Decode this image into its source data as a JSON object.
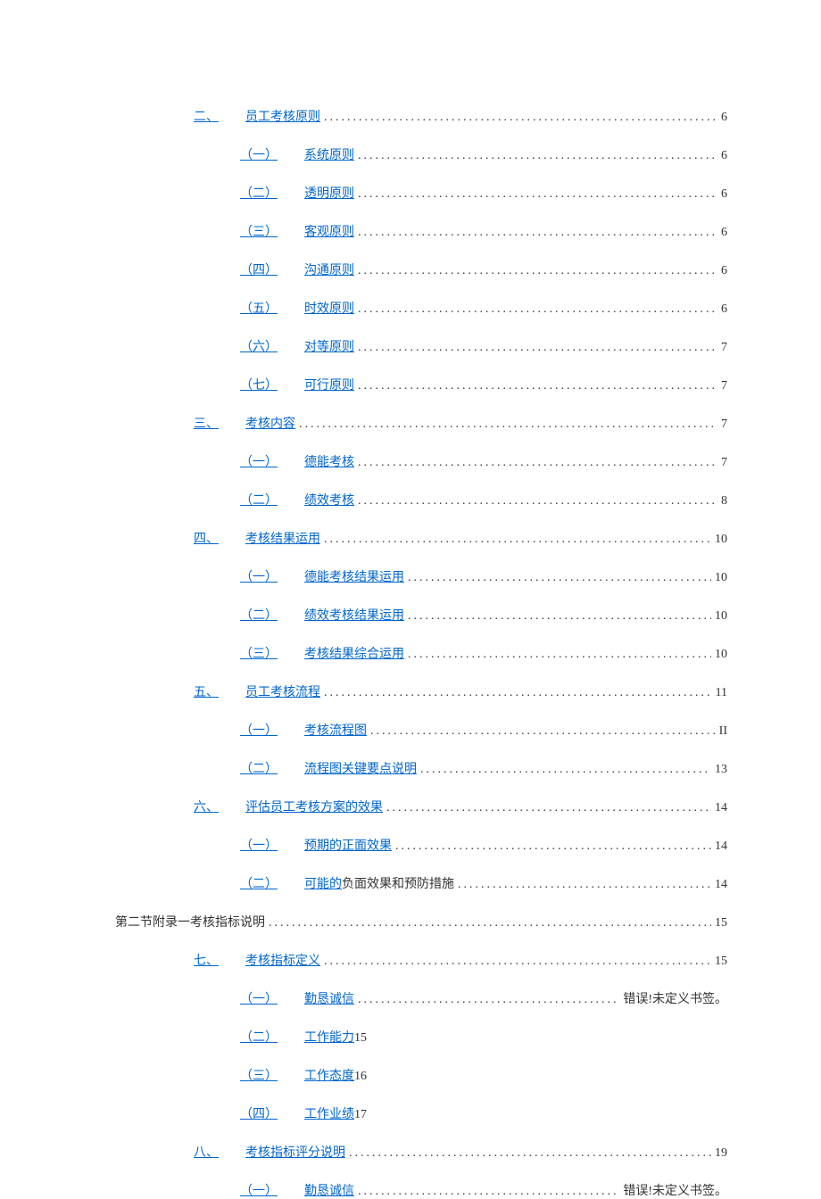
{
  "dots": "..................................................................................................",
  "error_text": "错误!未定义书签。",
  "toc": [
    {
      "level": 1,
      "prefix": "二、",
      "title": "员工考核原则",
      "page": "6",
      "style": "normal"
    },
    {
      "level": 2,
      "prefix": "（一）",
      "title": "系统原则",
      "page": "6",
      "style": "normal"
    },
    {
      "level": 2,
      "prefix": "（二）",
      "title": "透明原则",
      "page": "6",
      "style": "normal"
    },
    {
      "level": 2,
      "prefix": "（三）",
      "title": "客观原则",
      "page": "6",
      "style": "normal"
    },
    {
      "level": 2,
      "prefix": "（四）",
      "title": "沟通原则",
      "page": "6",
      "style": "normal"
    },
    {
      "level": 2,
      "prefix": "（五）",
      "title": "时效原则",
      "page": "6",
      "style": "normal"
    },
    {
      "level": 2,
      "prefix": "（六）",
      "title": "对等原则",
      "page": "7",
      "style": "normal"
    },
    {
      "level": 2,
      "prefix": "（七）",
      "title": "可行原则",
      "page": "7",
      "style": "normal"
    },
    {
      "level": 1,
      "prefix": "三、",
      "title": "考核内容",
      "page": "7",
      "style": "normal"
    },
    {
      "level": 2,
      "prefix": "（一）",
      "title": "德能考核",
      "page": "7",
      "style": "normal"
    },
    {
      "level": 2,
      "prefix": "（二）",
      "title": "绩效考核",
      "page": "8",
      "style": "normal"
    },
    {
      "level": 1,
      "prefix": "四、",
      "title": "考核结果运用",
      "page": "10",
      "style": "normal"
    },
    {
      "level": 2,
      "prefix": "（一）",
      "title": "德能考核结果运用",
      "page": "10",
      "style": "normal"
    },
    {
      "level": 2,
      "prefix": "（二）",
      "title": "绩效考核结果运用",
      "page": "10",
      "style": "normal"
    },
    {
      "level": 2,
      "prefix": "（三）",
      "title": "考核结果综合运用",
      "page": "10",
      "style": "normal"
    },
    {
      "level": 1,
      "prefix": "五、",
      "title": "员工考核流程",
      "page": "11",
      "style": "normal"
    },
    {
      "level": 2,
      "prefix": "（一）",
      "title": "考核流程图",
      "page": "II",
      "style": "normal"
    },
    {
      "level": 2,
      "prefix": "（二）",
      "title": "流程图关键要点说明",
      "page": "13",
      "style": "normal"
    },
    {
      "level": 1,
      "prefix": "六、",
      "title": "评估员工考核方案的效果",
      "page": "14",
      "style": "normal"
    },
    {
      "level": 2,
      "prefix": "（一）",
      "title": "预期的正面效果",
      "page": "14",
      "style": "normal"
    },
    {
      "level": 2,
      "prefix": "（二）",
      "title_link": "可能的",
      "title_plain": "负面效果和预防措施",
      "page": "14",
      "style": "partial"
    },
    {
      "level": 0,
      "prefix": "",
      "title": "第二节附录一考核指标说明",
      "page": "15",
      "style": "plain"
    },
    {
      "level": 1,
      "prefix": "七、",
      "title": "考核指标定义",
      "page": "15",
      "style": "normal"
    },
    {
      "level": 2,
      "prefix": "（一）",
      "title": "勤恳诚信",
      "page": "",
      "style": "error"
    },
    {
      "level": 2,
      "prefix": "（二）",
      "title": "工作能力",
      "page": "15",
      "style": "inline"
    },
    {
      "level": 2,
      "prefix": "（三）",
      "title": "工作态度",
      "page": "16",
      "style": "inline"
    },
    {
      "level": 2,
      "prefix": "（四）",
      "title": "工作业绩",
      "page": "17",
      "style": "inline"
    },
    {
      "level": 1,
      "prefix": "八、",
      "title": "考核指标评分说明",
      "page": "19",
      "style": "normal"
    },
    {
      "level": 2,
      "prefix": "（一）",
      "title": "勤恳诚信",
      "page": "",
      "style": "error"
    }
  ]
}
